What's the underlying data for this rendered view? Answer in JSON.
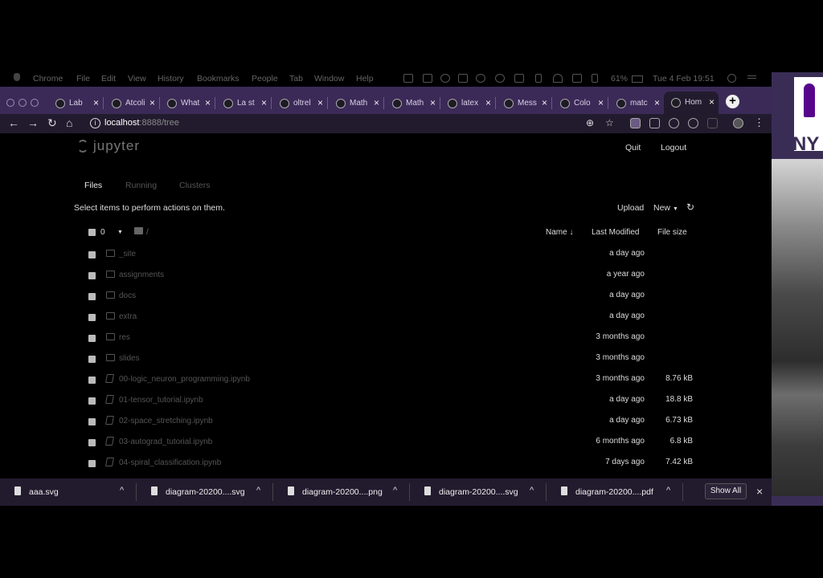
{
  "menubar": {
    "items": [
      "Chrome",
      "File",
      "Edit",
      "View",
      "History",
      "Bookmarks",
      "People",
      "Tab",
      "Window",
      "Help"
    ],
    "battery": "61%",
    "clock": "Tue 4 Feb  19:51"
  },
  "tabs": [
    {
      "label": "Lab",
      "icon": "github-icon"
    },
    {
      "label": "Atcoli",
      "icon": "github-icon"
    },
    {
      "label": "What",
      "icon": "wikipedia-icon"
    },
    {
      "label": "La st",
      "icon": "globe-icon"
    },
    {
      "label": "oltrel",
      "icon": "star-icon"
    },
    {
      "label": "Math",
      "icon": "math-icon"
    },
    {
      "label": "Math",
      "icon": "math-icon"
    },
    {
      "label": "latex",
      "icon": "latex-icon"
    },
    {
      "label": "Mess",
      "icon": "message-icon"
    },
    {
      "label": "Colo",
      "icon": "color-icon"
    },
    {
      "label": "matc",
      "icon": "globe-icon"
    },
    {
      "label": "Hom",
      "icon": "jupyter-icon"
    }
  ],
  "address": {
    "host": "localhost",
    "rest": ":8888/tree"
  },
  "jupyter": {
    "logo_text": "jupyter",
    "quit": "Quit",
    "logout": "Logout",
    "tabs": [
      "Files",
      "Running",
      "Clusters"
    ],
    "select_hint": "Select items to perform actions on them.",
    "upload": "Upload",
    "new": "New",
    "selected_count": "0",
    "path": "/",
    "columns": {
      "name": "Name",
      "modified": "Last Modified",
      "size": "File size"
    },
    "rows": [
      {
        "name": "_site",
        "type": "folder",
        "modified": "a day ago",
        "size": ""
      },
      {
        "name": "assignments",
        "type": "folder",
        "modified": "a year ago",
        "size": ""
      },
      {
        "name": "docs",
        "type": "folder",
        "modified": "a day ago",
        "size": ""
      },
      {
        "name": "extra",
        "type": "folder",
        "modified": "a day ago",
        "size": ""
      },
      {
        "name": "res",
        "type": "folder",
        "modified": "3 months ago",
        "size": ""
      },
      {
        "name": "slides",
        "type": "folder",
        "modified": "3 months ago",
        "size": ""
      },
      {
        "name": "00-logic_neuron_programming.ipynb",
        "type": "notebook",
        "modified": "3 months ago",
        "size": "8.76 kB"
      },
      {
        "name": "01-tensor_tutorial.ipynb",
        "type": "notebook",
        "modified": "a day ago",
        "size": "18.8 kB"
      },
      {
        "name": "02-space_stretching.ipynb",
        "type": "notebook",
        "modified": "a day ago",
        "size": "6.73 kB"
      },
      {
        "name": "03-autograd_tutorial.ipynb",
        "type": "notebook",
        "modified": "6 months ago",
        "size": "6.8 kB"
      },
      {
        "name": "04-spiral_classification.ipynb",
        "type": "notebook",
        "modified": "7 days ago",
        "size": "7.42 kB"
      }
    ]
  },
  "downloads": {
    "items": [
      "aaa.svg",
      "diagram-20200....svg",
      "diagram-20200....png",
      "diagram-20200....svg",
      "diagram-20200....pdf"
    ],
    "show_all": "Show All"
  },
  "side": {
    "logo_text": "NY"
  }
}
